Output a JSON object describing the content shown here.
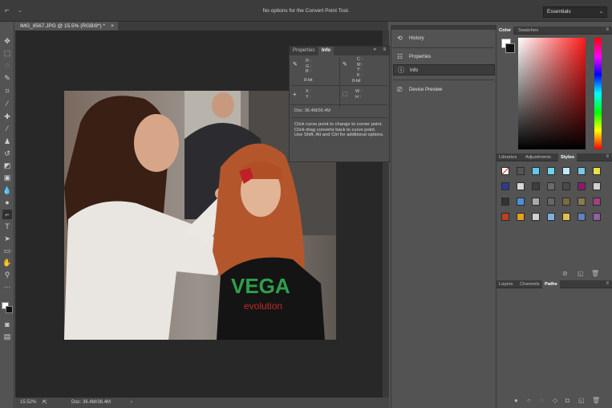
{
  "options_bar": {
    "tool_icon": "convert-point-tool-icon",
    "message": "No options for the Convert Point Tool.",
    "workspace": "Essentials"
  },
  "document": {
    "tab_title": "IMG_8567.JPG @ 15.5% (RGB/8*) *",
    "close_glyph": "×"
  },
  "status_bar": {
    "zoom": "15.52%",
    "doc_size": "Doc: 36.4M/36.4M",
    "arrow": "›"
  },
  "info_panel": {
    "tabs": [
      "Properties",
      "Info"
    ],
    "active_tab": "Info",
    "rgb_labels": [
      "R :",
      "G :",
      "B :"
    ],
    "cmyk_labels": [
      "C :",
      "M :",
      "Y :",
      "K :"
    ],
    "bit_depth_left": "8-bit",
    "bit_depth_right": "8-bit",
    "xy_labels": [
      "X :",
      "Y :"
    ],
    "wh_labels": [
      "W :",
      "H :"
    ],
    "doc_size": "Doc: 36.4M/36.4M",
    "tip": "Click curve point to change to corner point. Click-drag converts back to curve point. Use Shift, Alt and Ctrl for additional options."
  },
  "dock": {
    "items": [
      {
        "label": "History",
        "icon": "history-icon"
      },
      {
        "label": "Properties",
        "icon": "properties-icon"
      },
      {
        "label": "Info",
        "icon": "info-icon"
      },
      {
        "label": "Device Preview",
        "icon": "device-preview-icon"
      }
    ]
  },
  "color_panel": {
    "tabs": [
      "Color",
      "Swatches"
    ],
    "active_tab": "Color",
    "foreground": "#ffffff",
    "background": "#111111"
  },
  "styles_panel": {
    "tabs": [
      "Libraries",
      "Adjustments",
      "Styles"
    ],
    "active_tab": "Styles"
  },
  "layers_panel": {
    "tabs": [
      "Layers",
      "Channels",
      "Paths"
    ],
    "active_tab": "Paths"
  },
  "photo": {
    "shirt_text_1": "VEGA",
    "shirt_text_2": "evolution"
  }
}
